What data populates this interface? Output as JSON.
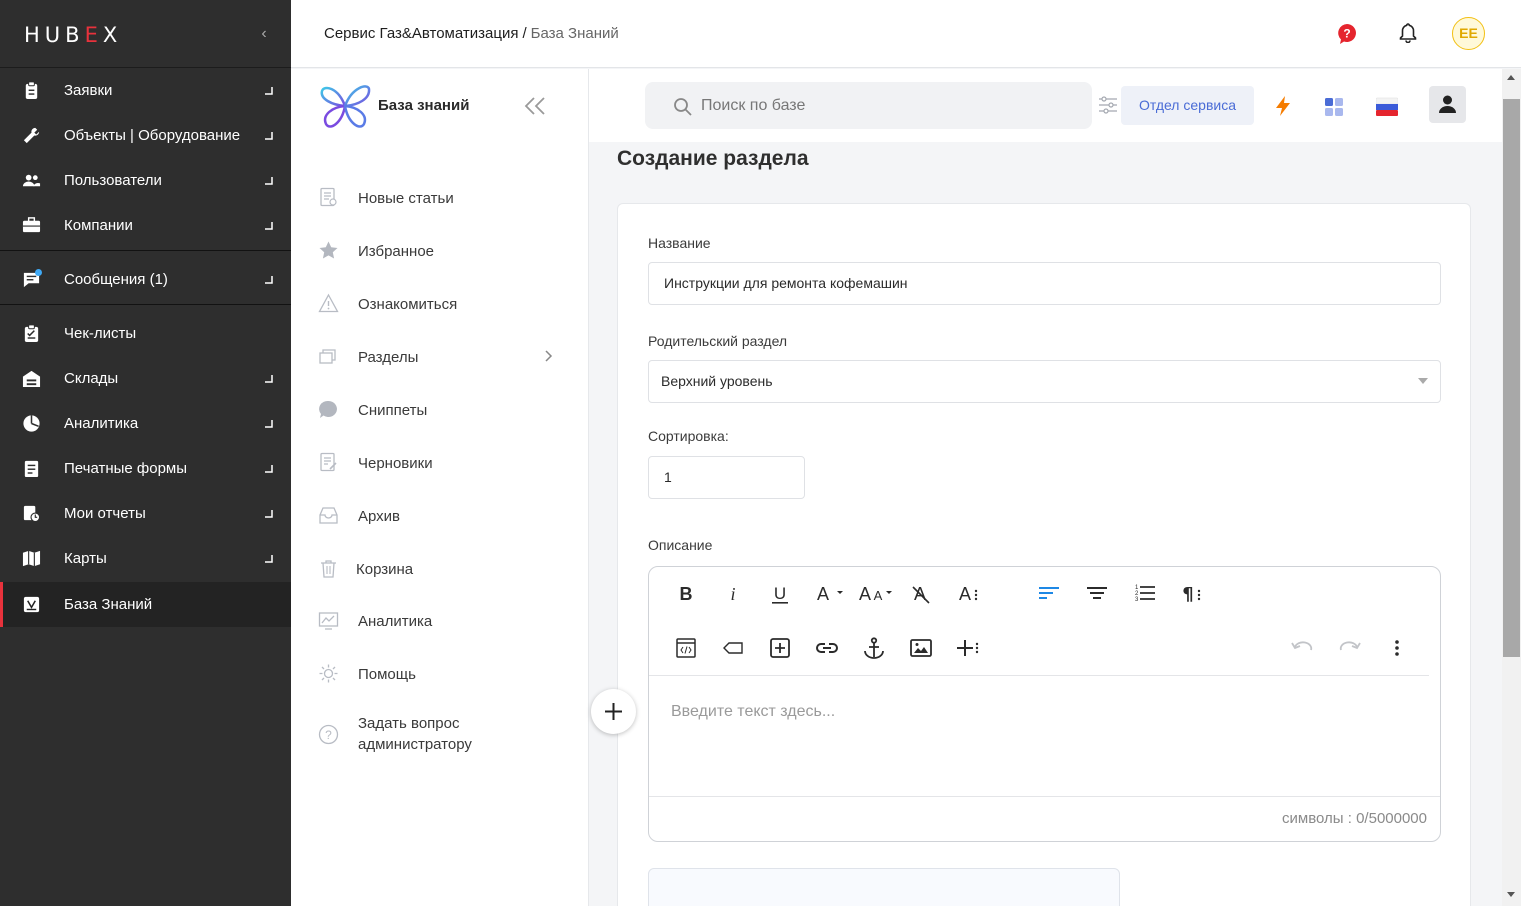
{
  "app": {
    "logo_text": "HUBEX",
    "collapse_label": "‹"
  },
  "sidebar": {
    "items": [
      {
        "label": "Заявки",
        "icon": "clipboard-icon",
        "has_arrow": true
      },
      {
        "label": "Объекты | Оборудование",
        "icon": "wrench-icon",
        "has_arrow": true
      },
      {
        "label": "Пользователи",
        "icon": "users-icon",
        "has_arrow": true
      },
      {
        "label": "Компании",
        "icon": "briefcase-icon",
        "has_arrow": true
      },
      {
        "label": "Сообщения (1)",
        "icon": "chat-icon",
        "has_arrow": true,
        "badge": true
      },
      {
        "label": "Чек-листы",
        "icon": "checklist-icon",
        "has_arrow": false
      },
      {
        "label": "Склады",
        "icon": "warehouse-icon",
        "has_arrow": true
      },
      {
        "label": "Аналитика",
        "icon": "pie-chart-icon",
        "has_arrow": true
      },
      {
        "label": "Печатные формы",
        "icon": "document-icon",
        "has_arrow": true
      },
      {
        "label": "Мои отчеты",
        "icon": "report-icon",
        "has_arrow": true
      },
      {
        "label": "Карты",
        "icon": "map-icon",
        "has_arrow": true
      },
      {
        "label": "База Знаний",
        "icon": "book-icon",
        "has_arrow": false,
        "active": true
      }
    ]
  },
  "header": {
    "breadcrumb_service": "Сервис Газ&Автоматизация",
    "breadcrumb_sep": "/",
    "breadcrumb_current": "База Знаний",
    "avatar_initials": "EE"
  },
  "kb": {
    "title": "База знаний",
    "items": [
      {
        "label": "Новые статьи",
        "icon": "new-articles-icon"
      },
      {
        "label": "Избранное",
        "icon": "star-icon"
      },
      {
        "label": "Ознакомиться",
        "icon": "warning-icon"
      },
      {
        "label": "Разделы",
        "icon": "sections-icon"
      },
      {
        "label": "Сниппеты",
        "icon": "snippet-icon"
      },
      {
        "label": "Черновики",
        "icon": "draft-icon"
      },
      {
        "label": "Архив",
        "icon": "archive-icon"
      },
      {
        "label": "Корзина",
        "icon": "trash-icon"
      },
      {
        "label": "Аналитика",
        "icon": "analytics-icon"
      },
      {
        "label": "Помощь",
        "icon": "help-gear-icon"
      },
      {
        "label": "Задать вопрос\nадминистратору",
        "icon": "question-icon"
      }
    ]
  },
  "search": {
    "placeholder": "Поиск по базе",
    "dept_button": "Отдел сервиса"
  },
  "form": {
    "page_title": "Создание раздела",
    "name_label": "Название",
    "name_value": "Инструкции для ремонта кофемашин",
    "parent_label": "Родительский раздел",
    "parent_value": "Верхний уровень",
    "sort_label": "Сортировка:",
    "sort_value": "1",
    "desc_label": "Описание",
    "editor_placeholder": "Введите текст здесь...",
    "char_count": "символы : 0/5000000"
  },
  "colors": {
    "sidebar_bg": "#2e2e2e",
    "accent_red": "#e8323c",
    "link_blue": "#4a6cd6",
    "bolt_orange": "#f57c00",
    "align_blue": "#1e88e5"
  }
}
